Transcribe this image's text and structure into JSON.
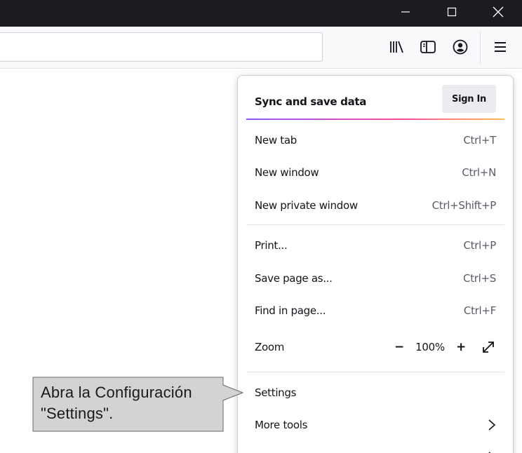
{
  "window": {
    "minimize_icon": "minimize-icon",
    "maximize_icon": "maximize-icon",
    "close_icon": "close-icon"
  },
  "toolbar": {
    "icons": [
      "library-icon",
      "sidebar-icon",
      "account-icon",
      "hamburger-menu-icon"
    ]
  },
  "menu": {
    "sync_label": "Sync and save data",
    "signin_label": "Sign In",
    "items": [
      {
        "label": "New tab",
        "shortcut": "Ctrl+T"
      },
      {
        "label": "New window",
        "shortcut": "Ctrl+N"
      },
      {
        "label": "New private window",
        "shortcut": "Ctrl+Shift+P"
      },
      {
        "label": "Print...",
        "shortcut": "Ctrl+P"
      },
      {
        "label": "Save page as...",
        "shortcut": "Ctrl+S"
      },
      {
        "label": "Find in page...",
        "shortcut": "Ctrl+F"
      }
    ],
    "zoom": {
      "label": "Zoom",
      "minus": "−",
      "value": "100%",
      "plus": "+"
    },
    "settings_label": "Settings",
    "more_tools_label": "More tools",
    "gradient_colors": [
      "#9059ff",
      "#ff4aa2",
      "#ffbd4f"
    ]
  },
  "callout": {
    "line1": "Abra la Configuración",
    "line2": "\"Settings\"."
  },
  "colors": {
    "titlebar": "#1c1b22",
    "toolbar": "#f9f9fb",
    "callout_fill": "#d3d3d3"
  }
}
